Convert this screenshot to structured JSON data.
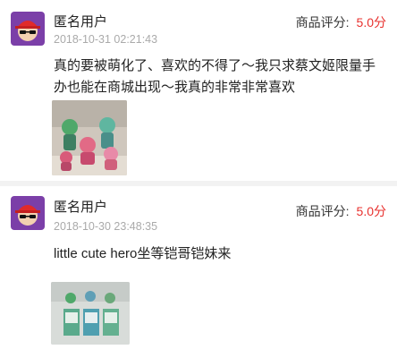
{
  "reviews": [
    {
      "username": "匿名用户",
      "datetime": "2018-10-31 02:21:43",
      "rating_label": "商品评分:",
      "rating_value": "5.0分",
      "text": "真的要被萌化了、喜欢的不得了～我只求蔡文姬限量手办也能在商城出现～我真的非常非常喜欢"
    },
    {
      "username": "匿名用户",
      "datetime": "2018-10-30 23:48:35",
      "rating_label": "商品评分:",
      "rating_value": "5.0分",
      "text": "little cute hero坐等铠哥铠妹来"
    }
  ],
  "colors": {
    "rating_value": "#e8312e",
    "date": "#aaaaaa",
    "separator": "#f2f2f2",
    "avatar_bg": "#7b3fa8"
  },
  "icons": [
    "avatar-cap-sunglasses"
  ]
}
